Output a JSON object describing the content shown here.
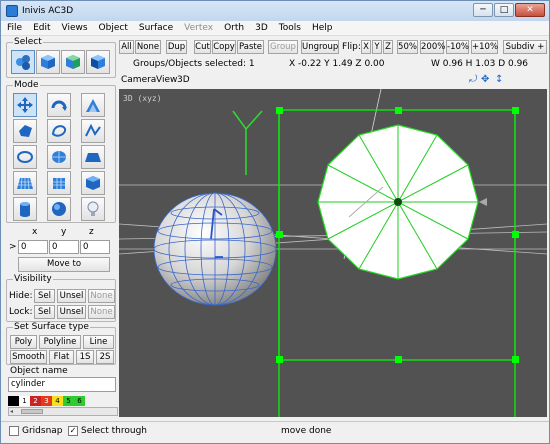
{
  "window": {
    "title": "Inivis AC3D",
    "min": "─",
    "max": "□",
    "close": "✕"
  },
  "menu": [
    {
      "label": "File",
      "enabled": true
    },
    {
      "label": "Edit",
      "enabled": true
    },
    {
      "label": "Views",
      "enabled": true
    },
    {
      "label": "Object",
      "enabled": true
    },
    {
      "label": "Surface",
      "enabled": true
    },
    {
      "label": "Vertex",
      "enabled": false
    },
    {
      "label": "Orth",
      "enabled": true
    },
    {
      "label": "3D",
      "enabled": true
    },
    {
      "label": "Tools",
      "enabled": true
    },
    {
      "label": "Help",
      "enabled": true
    }
  ],
  "select": {
    "label": "Select",
    "icons": [
      "select-vertices-icon",
      "select-objects-icon",
      "select-groups-icon",
      "select-surfaces-icon"
    ]
  },
  "mode": {
    "label": "Mode",
    "icons": [
      "move-icon",
      "rotate-icon",
      "scale-icon",
      "polygon-icon",
      "spline-icon",
      "poly-line-icon",
      "circle-icon",
      "disc-icon",
      "rect-icon",
      "grid-icon",
      "box-icon",
      "cube-icon",
      "cylinder-icon",
      "sphere-icon",
      "light-icon"
    ]
  },
  "coords": {
    "headers": [
      "x",
      "y",
      "z"
    ],
    "prefix": ">",
    "values": [
      "0",
      "0",
      "0"
    ],
    "move_to": "Move to"
  },
  "visibility": {
    "label": "Visibility",
    "hide": {
      "label": "Hide:",
      "sel": "Sel",
      "unsel": "Unsel",
      "none": "None"
    },
    "lock": {
      "label": "Lock:",
      "sel": "Sel",
      "unsel": "Unsel",
      "none": "None"
    }
  },
  "surface_type": {
    "label": "Set Surface type",
    "row1": [
      "Poly",
      "Polyline",
      "Line"
    ],
    "row2": [
      "Smooth",
      "Flat",
      "1S",
      "2S"
    ]
  },
  "object_name": {
    "label": "Object name",
    "value": "cylinder"
  },
  "palette": {
    "labels": [
      "1",
      "2",
      "3",
      "4",
      "5",
      "6"
    ],
    "colors": [
      "#000000",
      "#ffffff",
      "#cc2222",
      "#e23a1a",
      "#f7e01a",
      "#2ecc2e"
    ]
  },
  "toolbar": {
    "all": "All",
    "none": "None",
    "dup": "Dup",
    "cut": "Cut",
    "copy": "Copy",
    "paste": "Paste",
    "group": "Group",
    "ungroup": "Ungroup",
    "flip": "Flip:",
    "fx": "X",
    "fy": "Y",
    "fz": "Z",
    "z50": "50%",
    "z200": "200%",
    "m10": "-10%",
    "p10": "+10%",
    "subdiv": "Subdiv +"
  },
  "info": {
    "selected": "Groups/Objects selected: 1",
    "position": "X -0.22 Y 1.49 Z 0.00",
    "size": "W 0.96 H 1.03 D 0.96"
  },
  "viewbar": {
    "camera": "Camera",
    "view": "View",
    "threed": "3D"
  },
  "viewport": {
    "label": "3D (xyz)",
    "background": "#525252",
    "selection_color": "#00ff00"
  },
  "status": {
    "gridsnap": "Gridsnap",
    "gridsnap_checked": false,
    "select_through": "Select through",
    "select_through_checked": true,
    "message": "move done"
  }
}
